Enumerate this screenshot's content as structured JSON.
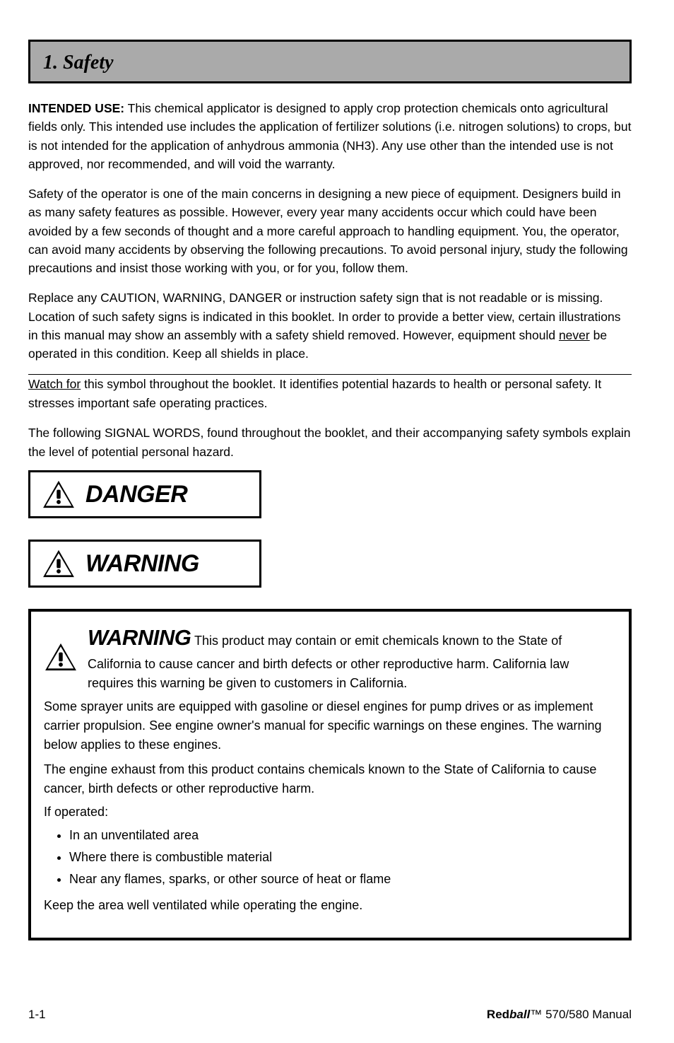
{
  "header": {
    "title": "1. Safety"
  },
  "body": {
    "intended_use_label": "INTENDED USE:",
    "intended_use_text": " This chemical applicator is designed to apply crop protection chemicals onto agricultural fields only. This intended use includes the application of fertilizer solutions (i.e. nitrogen solutions) to crops, but is not intended for the application of anhydrous ammonia (NH3). Any use other than the intended use is not approved, nor recommended, and will void the warranty.",
    "para2": "Safety of the operator is one of the main concerns in designing a new piece of equipment. Designers build in as many safety features as possible. However, every year many accidents occur which could have been avoided by a few seconds of thought and a more careful approach to handling equipment. You, the operator, can avoid many accidents by observing the following precautions. To avoid personal injury, study the following precautions and insist those working with you, or for you, follow them.",
    "para3_pre": "Replace any CAUTION, WARNING, DANGER or instruction safety sign that is not readable or is missing. Location of such safety signs is indicated in this booklet. In order to provide a better view, certain illustrations in this manual may show an assembly with a safety shield removed. However, equipment should ",
    "para3_never": "never",
    "para3_post": " be operated in this condition. Keep all shields in place.",
    "indent_pre": "Watch for",
    "indent_warning": " this symbol throughout the booklet. It identifies potential hazards to health or personal safety. It stresses important safe operating practices."
  },
  "signal_words": {
    "danger": "DANGER",
    "warning": "WARNING",
    "intro": "The following SIGNAL WORDS, found throughout the booklet, and their accompanying safety symbols explain the level of potential personal hazard."
  },
  "big_warning": {
    "heading_word": "WARNING",
    "heading_text": " This product may contain or emit chemicals known to the State of California to cause cancer and birth defects or other reproductive harm. California law requires this warning be given to customers in California.",
    "p1": "Some sprayer units are equipped with gasoline or diesel engines for pump drives or as implement carrier propulsion. See engine owner's manual for specific warnings on these engines. The warning below applies to these engines.",
    "p2": "The engine exhaust from this product contains chemicals known to the State of California to cause cancer, birth defects or other reproductive harm.",
    "bullets_intro": "If operated:",
    "bullets": [
      "In an unventilated area",
      "Where there is combustible material",
      "Near any flames, sparks, or other source of heat or flame"
    ],
    "ventilated": "Keep the area well ventilated while operating the engine."
  },
  "footer": {
    "left": "1-1",
    "right_brand": "Red",
    "right_italic1": "ball",
    "right_italic2": "™",
    "right_manual": " 570/580 Manual"
  }
}
